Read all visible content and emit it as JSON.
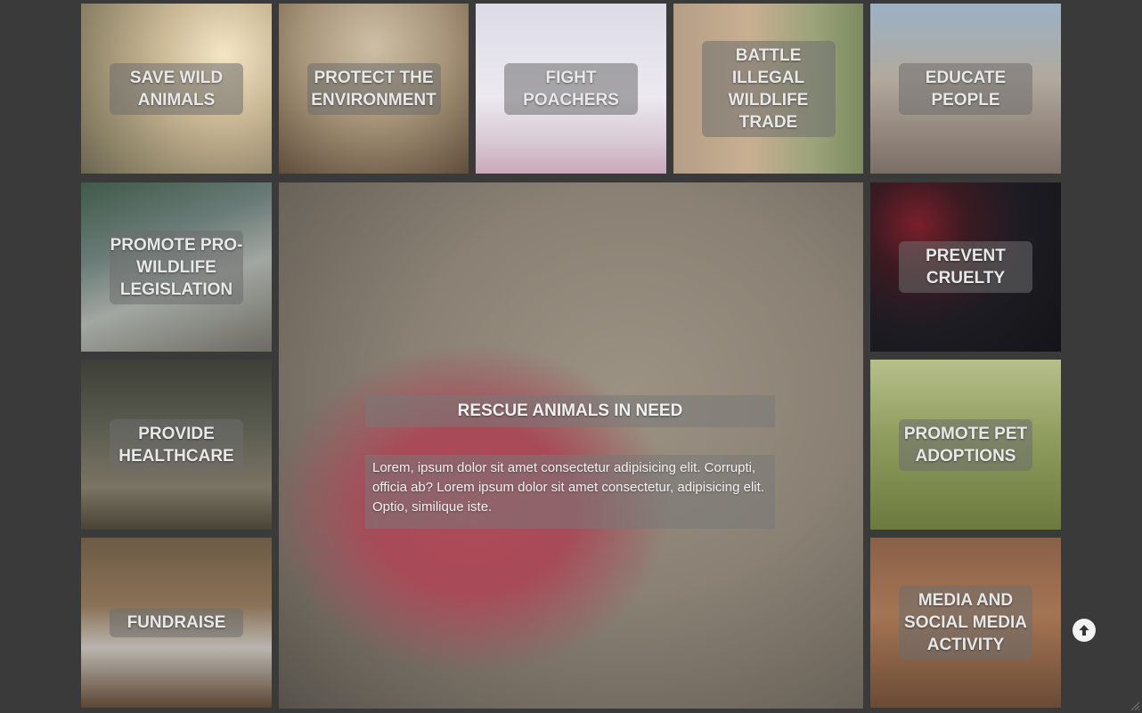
{
  "tiles": {
    "save_wild_animals": "SAVE WILD ANIMALS",
    "protect_environment": "PROTECT THE ENVIRONMENT",
    "fight_poachers": "FIGHT POACHERS",
    "battle_trade": "BATTLE ILLEGAL WILDLIFE TRADE",
    "educate_people": "EDUCATE PEOPLE",
    "promote_legislation": "PROMOTE PRO-WILDLIFE LEGISLATION",
    "prevent_cruelty": "PREVENT CRUELTY",
    "provide_healthcare": "PROVIDE HEALTHCARE",
    "promote_pet_adoptions": "PROMOTE PET ADOPTIONS",
    "fundraise": "FUNDRAISE",
    "media_social": "MEDIA AND SOCIAL MEDIA ACTIVITY"
  },
  "featured": {
    "title": "RESCUE ANIMALS IN NEED",
    "text": "Lorem, ipsum dolor sit amet consectetur adipisicing elit. Corrupti, officia ab? Lorem ipsum dolor sit amet consectetur, adipisicing elit. Optio, similique iste."
  },
  "icons": {
    "scroll_top": "arrow-up-circle-icon"
  }
}
